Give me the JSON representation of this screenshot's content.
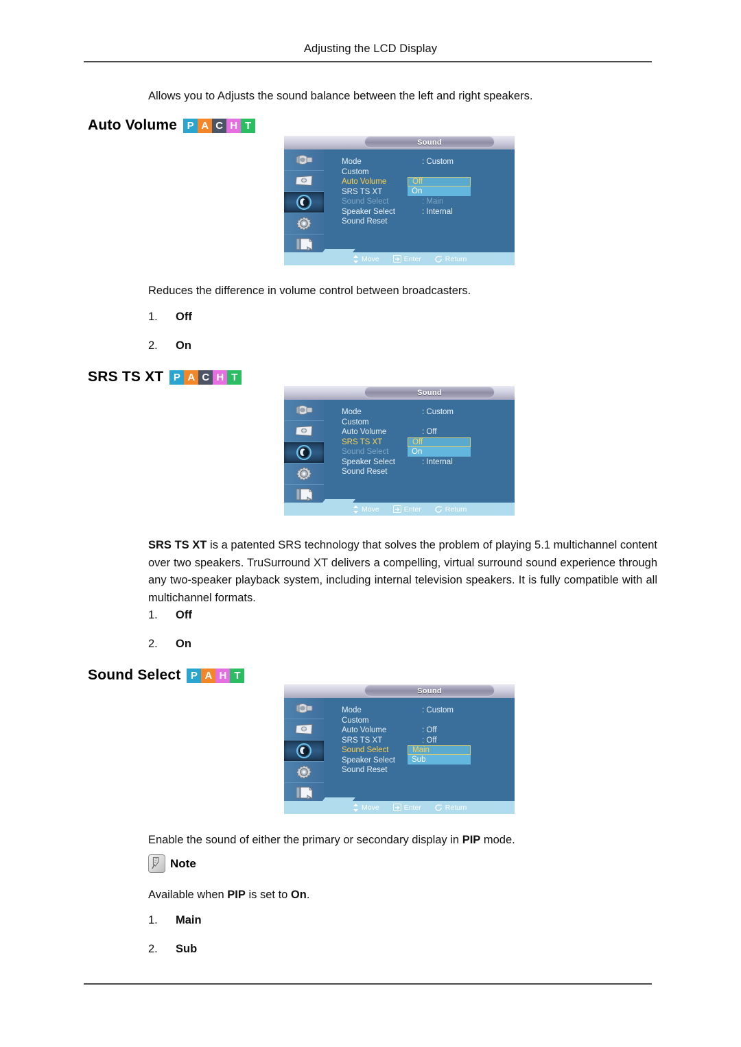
{
  "header": {
    "title": "Adjusting the LCD Display"
  },
  "intro": {
    "text": "Allows you to Adjusts the sound balance between the left and right speakers."
  },
  "badge_letters": {
    "pacht": [
      {
        "char": "P",
        "color": "#2aa5cf"
      },
      {
        "char": "A",
        "color": "#f4862a"
      },
      {
        "char": "C",
        "color": "#4b5566"
      },
      {
        "char": "H",
        "color": "#e56fe0"
      },
      {
        "char": "T",
        "color": "#2bbd62"
      }
    ],
    "paht": [
      {
        "char": "P",
        "color": "#2aa5cf"
      },
      {
        "char": "A",
        "color": "#f4862a"
      },
      {
        "char": "H",
        "color": "#e56fe0"
      },
      {
        "char": "T",
        "color": "#2bbd62"
      }
    ]
  },
  "sections": [
    {
      "heading": "Auto Volume",
      "description": "Reduces the difference in volume control between broadcasters.",
      "options": [
        {
          "num": "1.",
          "label": "Off"
        },
        {
          "num": "2.",
          "label": "On"
        }
      ]
    },
    {
      "heading": "SRS TS XT",
      "description_bold": "SRS TS XT",
      "description": " is a patented SRS technology that solves the problem of playing 5.1 multichannel content over two speakers. TruSurround XT delivers a compelling, virtual surround sound experience through any two-speaker playback system, including internal television speakers. It is fully compatible with all multichannel formats.",
      "options": [
        {
          "num": "1.",
          "label": "Off"
        },
        {
          "num": "2.",
          "label": "On"
        }
      ]
    },
    {
      "heading": "Sound Select",
      "description_pre": "Enable the sound of either the primary or secondary display in ",
      "description_bold": "PIP",
      "description_post": " mode.",
      "note_label": "Note",
      "note_pre": "Available when ",
      "note_bold1": "PIP",
      "note_mid": " is set to ",
      "note_bold2": "On",
      "note_post": ".",
      "options": [
        {
          "num": "1.",
          "label": "Main"
        },
        {
          "num": "2.",
          "label": "Sub"
        }
      ]
    }
  ],
  "osd": {
    "title": "Sound",
    "rail_icons": [
      "picture-input-icon",
      "display-picture-icon",
      "sound-icon",
      "setup-gear-icon",
      "multi-control-icon"
    ],
    "hints": [
      {
        "icon": "move-updown-icon",
        "label": "Move"
      },
      {
        "icon": "enter-icon",
        "label": "Enter"
      },
      {
        "icon": "return-icon",
        "label": "Return"
      }
    ],
    "menus": [
      {
        "name": "auto-volume-menu",
        "rows": [
          {
            "label": "Mode",
            "value": ": Custom",
            "state": "normal"
          },
          {
            "label": "Custom",
            "value": "",
            "state": "normal"
          },
          {
            "label": "Auto Volume",
            "value": ":",
            "state": "selected"
          },
          {
            "label": "SRS TS XT",
            "value": ":",
            "state": "normal"
          },
          {
            "label": "Sound Select",
            "value": ": Main",
            "state": "dimmed"
          },
          {
            "label": "Speaker Select",
            "value": ": Internal",
            "state": "normal"
          },
          {
            "label": "Sound Reset",
            "value": "",
            "state": "normal"
          }
        ],
        "popup": {
          "top_row": 2,
          "options": [
            "Off",
            "On"
          ],
          "current": "Off"
        }
      },
      {
        "name": "srs-ts-xt-menu",
        "rows": [
          {
            "label": "Mode",
            "value": ": Custom",
            "state": "normal"
          },
          {
            "label": "Custom",
            "value": "",
            "state": "normal"
          },
          {
            "label": "Auto Volume",
            "value": ": Off",
            "state": "normal"
          },
          {
            "label": "SRS TS XT",
            "value": ":",
            "state": "selected"
          },
          {
            "label": "Sound Select",
            "value": "",
            "state": "dimmed"
          },
          {
            "label": "Speaker Select",
            "value": ": Internal",
            "state": "normal"
          },
          {
            "label": "Sound Reset",
            "value": "",
            "state": "normal"
          }
        ],
        "popup": {
          "top_row": 3,
          "options": [
            "Off",
            "On"
          ],
          "current": "Off"
        }
      },
      {
        "name": "sound-select-menu",
        "rows": [
          {
            "label": "Mode",
            "value": ": Custom",
            "state": "normal"
          },
          {
            "label": "Custom",
            "value": "",
            "state": "normal"
          },
          {
            "label": "Auto Volume",
            "value": ": Off",
            "state": "normal"
          },
          {
            "label": "SRS TS XT",
            "value": ": Off",
            "state": "normal"
          },
          {
            "label": "Sound Select",
            "value": ":",
            "state": "selected"
          },
          {
            "label": "Speaker Select",
            "value": "",
            "state": "normal"
          },
          {
            "label": "Sound Reset",
            "value": "",
            "state": "normal"
          }
        ],
        "popup": {
          "top_row": 4,
          "options": [
            "Main",
            "Sub"
          ],
          "current": "Main"
        }
      }
    ]
  }
}
